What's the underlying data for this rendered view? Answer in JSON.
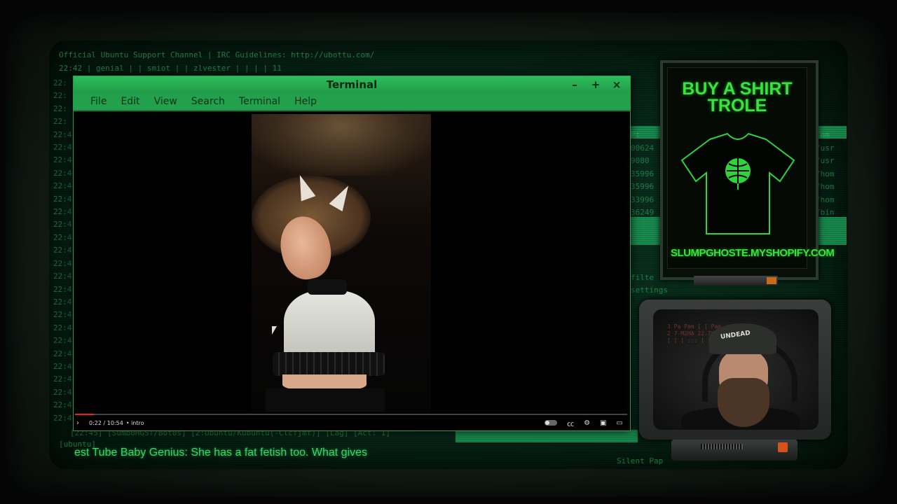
{
  "background": {
    "irc_topic": "Official Ubuntu Support Channel | IRC Guidelines: http://ubottu.com/",
    "irc_nicks": "22:42 | genial            | | smiot            | | zlvester         |        |  |    | 11",
    "timestamps": [
      "22:",
      "22:",
      "22:",
      "22:",
      "22:4",
      "22:4",
      "22:4",
      "22:4",
      "22:4",
      "22:4",
      "22:4",
      "22:4",
      "22:4",
      "22:4",
      "22:4",
      "22:4",
      "22:4",
      "22:4",
      "22:4",
      "22:4",
      "22:4",
      "22:4",
      "22:4",
      "22:4",
      "22:4",
      "22:4",
      "22:4"
    ],
    "proc_ids": [
      "Pt",
      "00624",
      "9080",
      "35996",
      "35996",
      "33996",
      "36249"
    ],
    "proc_paths": [
      "Com",
      "/usr",
      "/usr",
      "/hom",
      "/hom",
      "/hom",
      "/bin"
    ],
    "side_texts": [
      "filte",
      "settings"
    ],
    "status_line": "[22:45] [Sumb0HGST/Bot0s]  [2:Ubuntu/Kubuntu(-Clcfjmt)] [Lag] [Act: 1]",
    "status_tag": "[ubuntu]",
    "status_right": "Silent Pap",
    "ticker": "est Tube Baby Genius: She has a fat fetish too. What gives"
  },
  "terminal": {
    "title": "Terminal",
    "controls": {
      "minimize": "–",
      "maximize": "+",
      "close": "×"
    },
    "menu": [
      "File",
      "Edit",
      "View",
      "Search",
      "Terminal",
      "Help"
    ]
  },
  "video": {
    "time": "0:22 / 10:54",
    "chapter": "• intro",
    "progress": 0.034,
    "chevron": "›",
    "icons": [
      "autoplay-toggle",
      "cc-icon",
      "settings-icon",
      "miniplayer-icon",
      "theater-icon"
    ]
  },
  "ad": {
    "headline_line1": "BUY A SHIRT",
    "headline_line2": "TROLE",
    "url": "SLUMPGHOSTE.MYSHOPIFY.COM"
  },
  "webcam": {
    "cap_text": "UNDEAD",
    "bg_text": [
      "3 Pa Pam [ [ Pam",
      "2 7-M2HA 22.7%",
      "[ [ [ ::: [ ["
    ]
  },
  "colors": {
    "accent_green": "#39e23e",
    "window_green": "#2dbd5c",
    "led_orange": "#d2541c"
  }
}
